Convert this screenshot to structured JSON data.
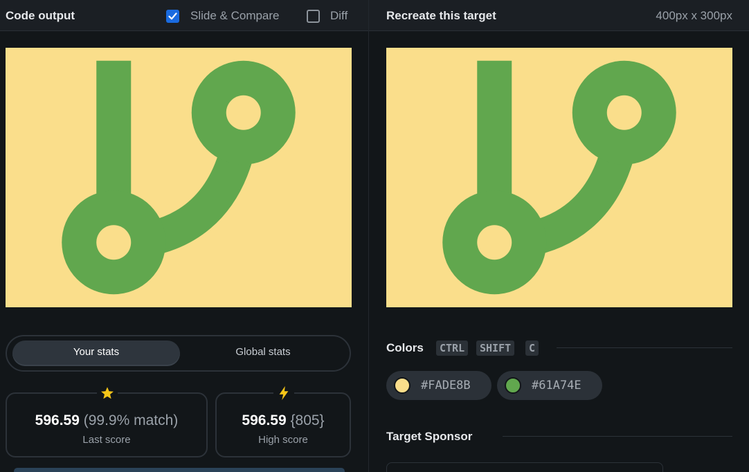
{
  "left": {
    "title": "Code output",
    "slide_compare_label": "Slide & Compare",
    "slide_compare_checked": true,
    "diff_label": "Diff",
    "diff_checked": false
  },
  "right": {
    "title": "Recreate this target",
    "size_label": "400px x 300px"
  },
  "stats": {
    "tab_your": "Your stats",
    "tab_global": "Global stats",
    "last_score_value": "596.59",
    "last_score_match": "(99.9% match)",
    "last_score_label": "Last score",
    "high_score_value": "596.59",
    "high_score_extra": "{805}",
    "high_score_label": "High score"
  },
  "colors": {
    "title": "Colors",
    "shortcut_keys": [
      "CTRL",
      "SHIFT",
      "C"
    ],
    "swatches": [
      {
        "hex": "#FADE8B",
        "color": "#fade8b"
      },
      {
        "hex": "#61A74E",
        "color": "#61a74e"
      }
    ]
  },
  "sponsor": {
    "title": "Target Sponsor"
  },
  "theme": {
    "background": "#121619",
    "accent_blue": "#1a6be0",
    "star_yellow": "#f5c518",
    "canvas_bg": "#fade8b",
    "shape_green": "#61a74e"
  },
  "icons": {
    "checkbox_on": "checkmark-icon",
    "last_score": "star-icon",
    "high_score": "lightning-bolt-icon"
  }
}
